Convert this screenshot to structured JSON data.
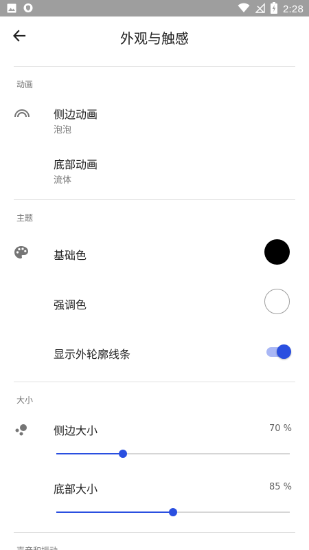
{
  "status_bar": {
    "time": "2:28",
    "icons": [
      "image-icon",
      "shield-icon",
      "wifi-icon",
      "no-signal-icon",
      "battery-charging-icon"
    ]
  },
  "app_bar": {
    "title": "外观与触感",
    "back_icon": "arrow-left-icon"
  },
  "sections": {
    "animation": {
      "header": "动画",
      "icon": "rainbow-icon",
      "side": {
        "title": "侧边动画",
        "value": "泡泡"
      },
      "bottom": {
        "title": "底部动画",
        "value": "流体"
      }
    },
    "theme": {
      "header": "主题",
      "icon": "palette-icon",
      "base_color": {
        "title": "基础色",
        "color": "#000000"
      },
      "accent_color": {
        "title": "强调色",
        "color": "#ffffff"
      },
      "outline": {
        "title": "显示外轮廓线条",
        "enabled": true
      }
    },
    "size": {
      "header": "大小",
      "icon": "bubbles-icon",
      "side": {
        "title": "侧边大小",
        "percent_label": "70 %",
        "slider_fraction": 0.285
      },
      "bottom": {
        "title": "底部大小",
        "percent_label": "85 %",
        "slider_fraction": 0.5
      }
    },
    "sound": {
      "header": "声音和振动"
    }
  },
  "colors": {
    "accent": "#2a4fe0",
    "accent_light": "#a9b7f5",
    "status_bar": "#9e9e9e"
  }
}
